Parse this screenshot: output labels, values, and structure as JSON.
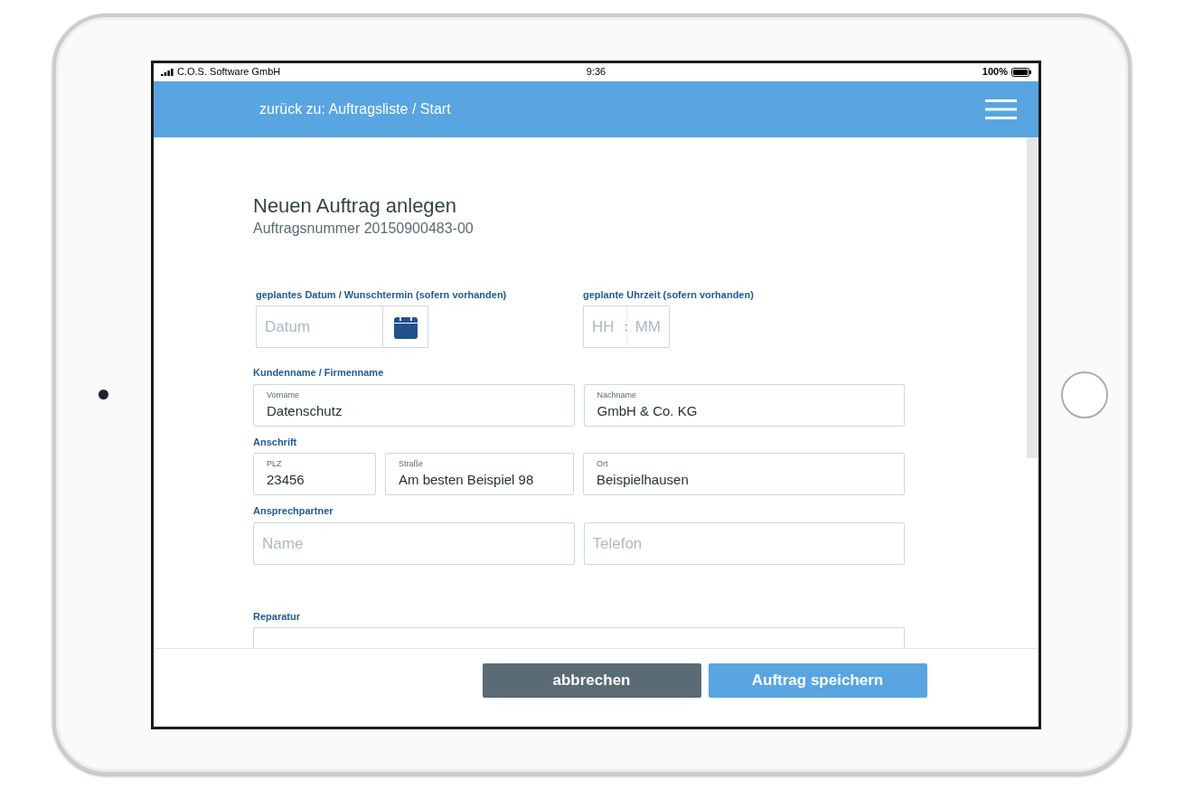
{
  "status_bar": {
    "carrier": "C.O.S. Software GmbH",
    "time": "9:36",
    "battery": "100%"
  },
  "header": {
    "back_link": "zurück zu: Auftragsliste / Start"
  },
  "form": {
    "title": "Neuen Auftrag anlegen",
    "order_number": "Auftragsnummer 20150900483-00",
    "date": {
      "label": "geplantes Datum / Wunschtermin (sofern vorhanden)",
      "placeholder": "Datum"
    },
    "time": {
      "label": "geplante Uhrzeit (sofern vorhanden)",
      "hour_placeholder": "HH",
      "separator": ":",
      "minute_placeholder": "MM"
    },
    "sections": [
      {
        "kind": "fields",
        "label": "Kundenname / Firmenname",
        "fields": [
          {
            "label": "Vorname",
            "value": "Datenschutz"
          },
          {
            "label": "Nachname",
            "value": "GmbH & Co. KG"
          }
        ]
      },
      {
        "kind": "fields",
        "label": "Anschrift",
        "fields": [
          {
            "label": "PLZ",
            "value": "23456"
          },
          {
            "label": "Straße",
            "value": "Am besten Beispiel 98"
          },
          {
            "label": "Ort",
            "value": "Beispielhausen"
          }
        ]
      },
      {
        "kind": "fields",
        "label": "Ansprechpartner",
        "fields": [
          {
            "placeholder": "Name"
          },
          {
            "placeholder": "Telefon"
          }
        ]
      },
      {
        "kind": "textarea",
        "label": "Reparatur"
      }
    ]
  },
  "buttons": [
    {
      "label": "abbrechen",
      "kind": "secondary"
    },
    {
      "label": "Auftrag speichern",
      "kind": "primary"
    }
  ]
}
